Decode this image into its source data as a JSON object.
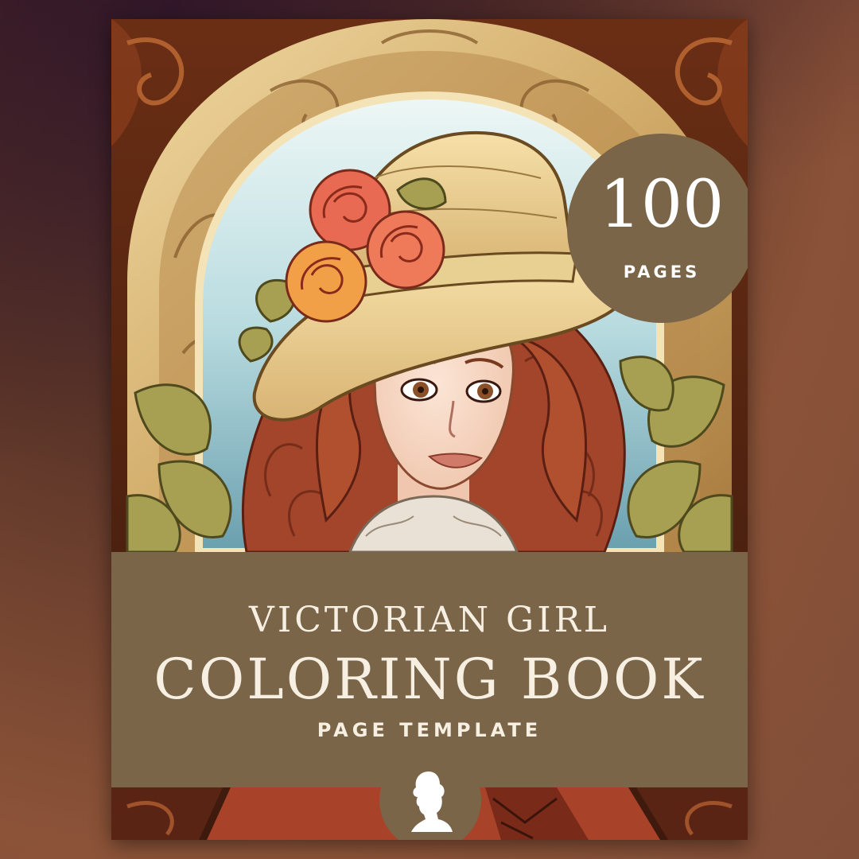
{
  "badge": {
    "number": "100",
    "label": "PAGES"
  },
  "title": {
    "line1": "VICTORIAN GIRL",
    "line2": "COLORING BOOK",
    "line3": "PAGE TEMPLATE"
  },
  "icons": {
    "emblem": "woman-silhouette-icon"
  },
  "colors": {
    "band": "#7a6548",
    "text": "#f6efe2",
    "frame_gold": "#d9b774",
    "hair": "#a8482a",
    "sky": "#cfe8ea"
  }
}
